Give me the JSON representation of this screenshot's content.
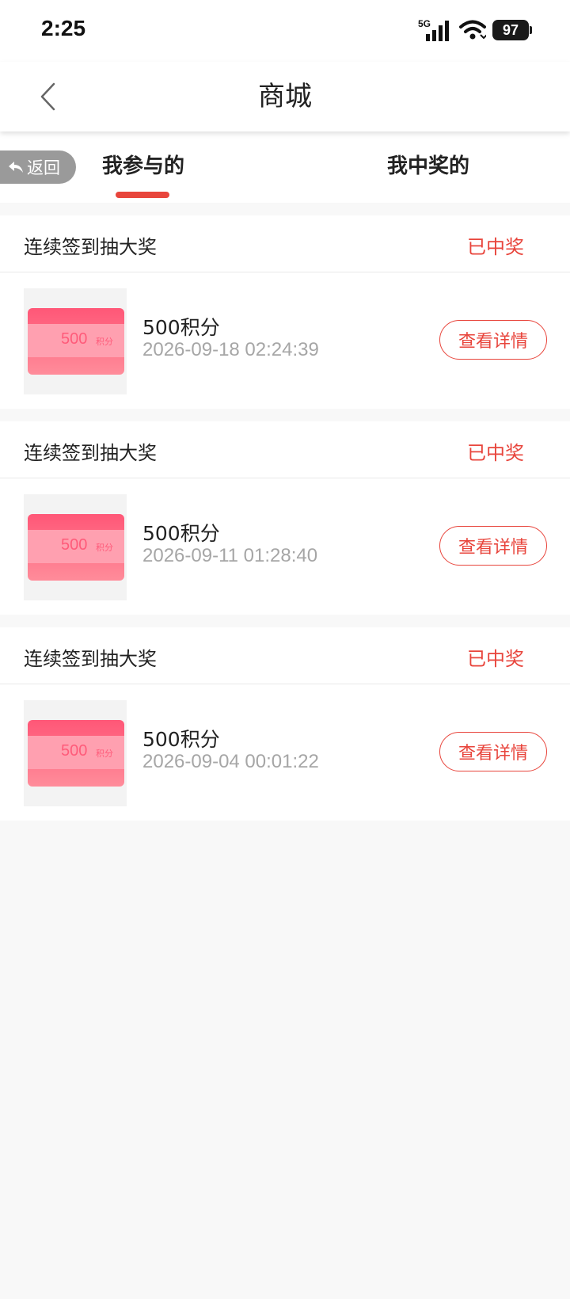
{
  "status_bar": {
    "time": "2:25",
    "network": "5G",
    "battery": "97"
  },
  "nav": {
    "title": "商城"
  },
  "floating_return": {
    "label": "返回"
  },
  "tabs": [
    {
      "label": "我参与的",
      "active": true
    },
    {
      "label": "我中奖的",
      "active": false
    }
  ],
  "colors": {
    "accent": "#e8453c",
    "coupon": "#ff5777"
  },
  "records": [
    {
      "title": "连续签到抽大奖",
      "status": "已中奖",
      "coupon_value": "500",
      "coupon_unit": "积分",
      "item_name": "500积分",
      "time": "2026-09-18 02:24:39",
      "button": "查看详情"
    },
    {
      "title": "连续签到抽大奖",
      "status": "已中奖",
      "coupon_value": "500",
      "coupon_unit": "积分",
      "item_name": "500积分",
      "time": "2026-09-11 01:28:40",
      "button": "查看详情"
    },
    {
      "title": "连续签到抽大奖",
      "status": "已中奖",
      "coupon_value": "500",
      "coupon_unit": "积分",
      "item_name": "500积分",
      "time": "2026-09-04 00:01:22",
      "button": "查看详情"
    }
  ]
}
